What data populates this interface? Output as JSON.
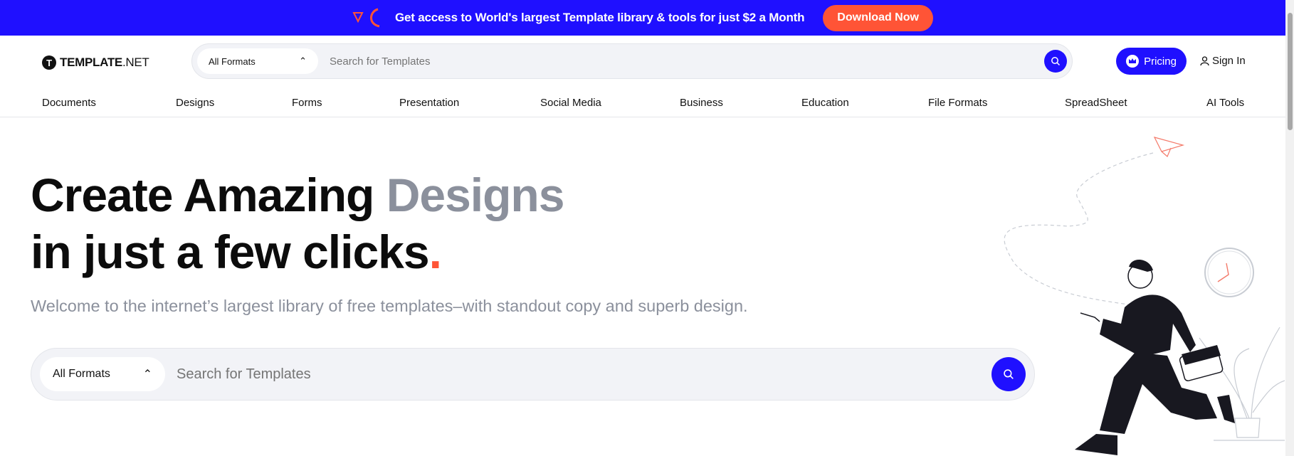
{
  "banner": {
    "message": "Get access to World's largest Template library & tools for just $2 a Month",
    "cta": "Download Now"
  },
  "header": {
    "logo_mark": "T",
    "logo_text": "TEMPLATE",
    "logo_suffix": ".NET",
    "format": "All Formats",
    "search_placeholder": "Search for Templates",
    "pricing": "Pricing",
    "sign_in": "Sign In"
  },
  "nav": [
    "Documents",
    "Designs",
    "Forms",
    "Presentation",
    "Social Media",
    "Business",
    "Education",
    "File Formats",
    "SpreadSheet",
    "AI Tools"
  ],
  "hero": {
    "line1": "Create Amazing ",
    "highlight": "Designs",
    "line2": "in just a few clicks",
    "dot": ".",
    "subtitle": "Welcome to the internet’s largest library of free templates–with standout copy and superb design.",
    "format": "All Formats",
    "search_placeholder": "Search for Templates"
  },
  "colors": {
    "brand": "#1f10ff",
    "accent": "#ff5436"
  }
}
